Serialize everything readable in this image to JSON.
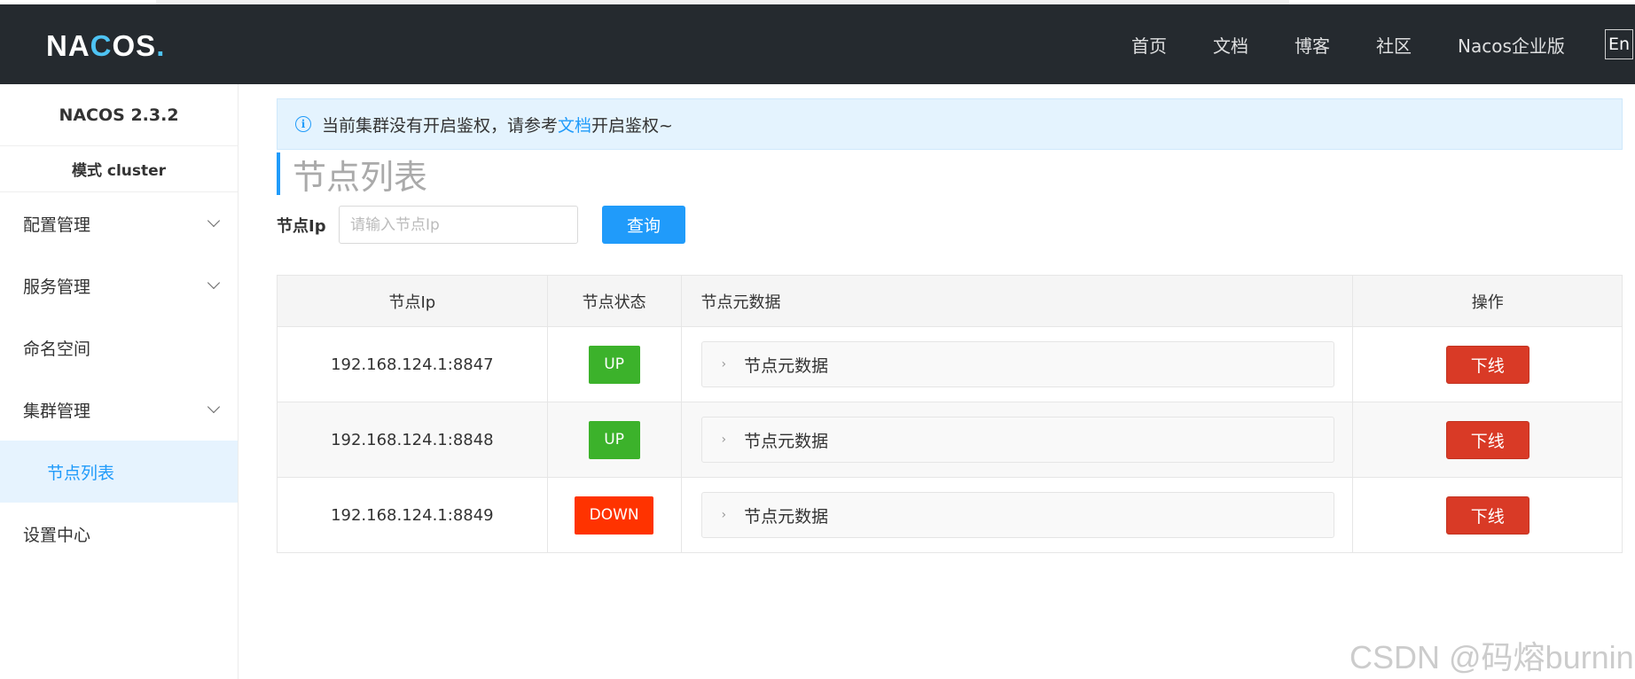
{
  "header": {
    "logo": {
      "part1": "NA",
      "part2": "C",
      "part3": "OS",
      "dot": "."
    },
    "nav": [
      {
        "label": "首页"
      },
      {
        "label": "文档"
      },
      {
        "label": "博客"
      },
      {
        "label": "社区"
      },
      {
        "label": "Nacos企业版"
      }
    ],
    "lang": "En"
  },
  "sidebar": {
    "version": "NACOS 2.3.2",
    "mode": "模式 cluster",
    "items": [
      {
        "label": "配置管理",
        "has_chevron": true
      },
      {
        "label": "服务管理",
        "has_chevron": true
      },
      {
        "label": "命名空间",
        "has_chevron": false
      },
      {
        "label": "集群管理",
        "has_chevron": true
      },
      {
        "label": "节点列表",
        "active": true
      },
      {
        "label": "设置中心",
        "has_chevron": false
      }
    ]
  },
  "notice": {
    "icon": "info-icon",
    "text_before": "当前集群没有开启鉴权，请参考",
    "link": "文档",
    "text_after": "开启鉴权~"
  },
  "page": {
    "title": "节点列表",
    "search_label": "节点Ip",
    "search_placeholder": "请输入节点Ip",
    "search_button": "查询"
  },
  "table": {
    "headers": [
      "节点Ip",
      "节点状态",
      "节点元数据",
      "操作"
    ],
    "rows": [
      {
        "ip": "192.168.124.1:8847",
        "status": "UP",
        "meta": "节点元数据",
        "action": "下线"
      },
      {
        "ip": "192.168.124.1:8848",
        "status": "UP",
        "meta": "节点元数据",
        "action": "下线"
      },
      {
        "ip": "192.168.124.1:8849",
        "status": "DOWN",
        "meta": "节点元数据",
        "action": "下线"
      }
    ]
  },
  "colors": {
    "accent": "#209bfa",
    "header_bg": "#252a2f",
    "status_up": "#3cb22b",
    "status_down": "#ff3300",
    "offline_button": "#d93a26"
  },
  "watermark": "CSDN @码熔burning"
}
